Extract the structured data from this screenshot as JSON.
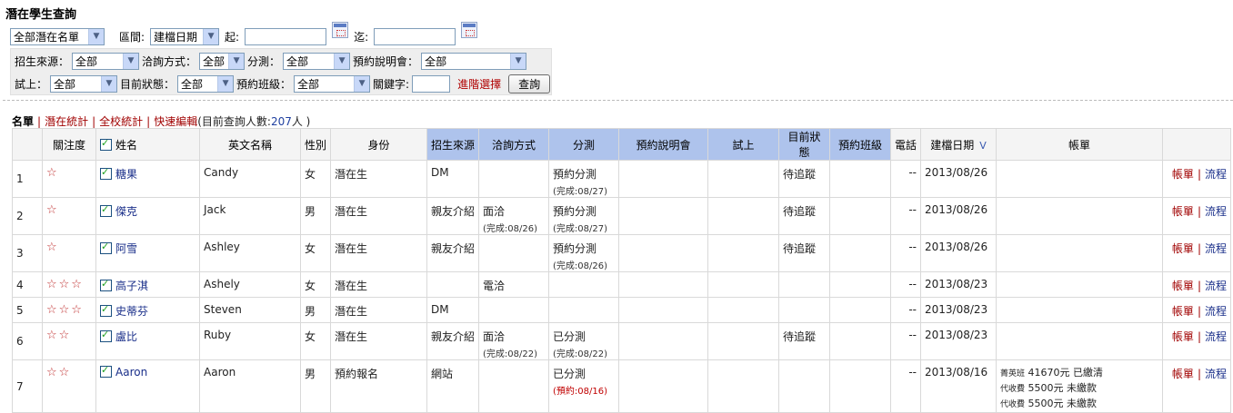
{
  "page": {
    "title": "潛在學生查詢"
  },
  "search": {
    "list_select": "全部潛在名單",
    "period_label": "區間:",
    "date_type_select": "建檔日期",
    "from_label": "起:",
    "to_label": "迄:",
    "from_value": "",
    "to_value": ""
  },
  "filters": {
    "source_label": "招生來源：",
    "source_value": "全部",
    "contact_label": "洽詢方式：",
    "contact_value": "全部",
    "placement_label": "分測：",
    "placement_value": "全部",
    "briefing_label": "預約說明會：",
    "briefing_value": "全部",
    "trial_label": "試上：",
    "trial_value": "全部",
    "status_label": "目前狀態：",
    "status_value": "全部",
    "class_label": "預約班級：",
    "class_value": "全部",
    "keyword_label": "關鍵字:",
    "keyword_value": "",
    "advanced_link": "進階選擇",
    "query_button": "查詢"
  },
  "tabs": {
    "list": "名單",
    "potential_stats": "潛在統計",
    "school_stats": "全校統計",
    "quick_edit": "快速編輯",
    "count_prefix": "(目前查詢人數:",
    "count_value": "207",
    "count_suffix": "人 )"
  },
  "table": {
    "headers": [
      "",
      "關注度",
      "姓名",
      "英文名稱",
      "性別",
      "身份",
      "招生來源",
      "洽詢方式",
      "分測",
      "預約說明會",
      "試上",
      "目前狀態",
      "預約班級",
      "電話",
      "建檔日期",
      "帳單",
      ""
    ],
    "sort_indicator": "V",
    "rows": [
      {
        "idx": "1",
        "stars": "☆",
        "name": "糖果",
        "en": "Candy",
        "gender": "女",
        "identity": "潛在生",
        "source": "DM",
        "contact": "",
        "contact_sub": "",
        "placement": "預約分測",
        "placement_sub": "(完成:08/27)",
        "briefing": "",
        "trial": "",
        "status": "待追蹤",
        "class": "",
        "phone": "--",
        "date": "2013/08/26",
        "bill": [],
        "act1": "帳單",
        "act2": "流程"
      },
      {
        "idx": "2",
        "stars": "☆",
        "name": "傑克",
        "en": "Jack",
        "gender": "男",
        "identity": "潛在生",
        "source": "親友介紹",
        "contact": "面洽",
        "contact_sub": "(完成:08/26)",
        "placement": "預約分測",
        "placement_sub": "(完成:08/27)",
        "briefing": "",
        "trial": "",
        "status": "待追蹤",
        "class": "",
        "phone": "--",
        "date": "2013/08/26",
        "bill": [],
        "act1": "帳單",
        "act2": "流程"
      },
      {
        "idx": "3",
        "stars": "☆",
        "name": "阿雪",
        "en": "Ashley",
        "gender": "女",
        "identity": "潛在生",
        "source": "親友介紹",
        "contact": "",
        "contact_sub": "",
        "placement": "預約分測",
        "placement_sub": "(完成:08/26)",
        "briefing": "",
        "trial": "",
        "status": "待追蹤",
        "class": "",
        "phone": "--",
        "date": "2013/08/26",
        "bill": [],
        "act1": "帳單",
        "act2": "流程"
      },
      {
        "idx": "4",
        "stars": "☆☆☆",
        "name": "高子淇",
        "en": "Ashely",
        "gender": "女",
        "identity": "潛在生",
        "source": "",
        "contact": "電洽",
        "contact_sub": "",
        "placement": "",
        "placement_sub": "",
        "briefing": "",
        "trial": "",
        "status": "",
        "class": "",
        "phone": "--",
        "date": "2013/08/23",
        "bill": [],
        "act1": "帳單",
        "act2": "流程"
      },
      {
        "idx": "5",
        "stars": "☆☆☆",
        "name": "史蒂芬",
        "en": "Steven",
        "gender": "男",
        "identity": "潛在生",
        "source": "DM",
        "contact": "",
        "contact_sub": "",
        "placement": "",
        "placement_sub": "",
        "briefing": "",
        "trial": "",
        "status": "",
        "class": "",
        "phone": "--",
        "date": "2013/08/23",
        "bill": [],
        "act1": "帳單",
        "act2": "流程"
      },
      {
        "idx": "6",
        "stars": "☆☆",
        "name": "盧比",
        "en": "Ruby",
        "gender": "女",
        "identity": "潛在生",
        "source": "親友介紹",
        "contact": "面洽",
        "contact_sub": "(完成:08/22)",
        "placement": "已分測",
        "placement_sub": "(完成:08/22)",
        "briefing": "",
        "trial": "",
        "status": "待追蹤",
        "class": "",
        "phone": "--",
        "date": "2013/08/23",
        "bill": [],
        "act1": "帳單",
        "act2": "流程"
      },
      {
        "idx": "7",
        "stars": "☆☆",
        "name": "Aaron",
        "en": "Aaron",
        "gender": "男",
        "identity": "預約報名",
        "source": "網站",
        "contact": "",
        "contact_sub": "",
        "placement": "已分測",
        "placement_sub": "(預約:08/16)",
        "briefing": "",
        "trial": "",
        "status": "",
        "class": "",
        "phone": "--",
        "date": "2013/08/16",
        "bill": [
          {
            "item": "菁英班",
            "amount": "41670元",
            "state": "已繳清"
          },
          {
            "item": "代收費",
            "amount": "5500元",
            "state": "未繳款"
          },
          {
            "item": "代收費",
            "amount": "5500元",
            "state": "未繳款"
          }
        ],
        "act1": "帳單",
        "act2": "流程"
      }
    ]
  },
  "colors": {
    "header_highlight": "#aec3ec",
    "link_red": "#a00000",
    "link_blue": "#1a2f8a",
    "star": "#c03030"
  },
  "icons": [
    "calendar-icon",
    "chevron-down-icon",
    "star-icon",
    "checkbox-icon",
    "sort-down-icon"
  ]
}
